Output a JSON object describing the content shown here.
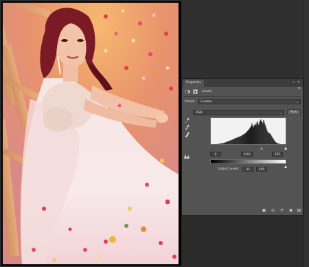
{
  "properties_panel": {
    "tab_label": "Properties",
    "collapse_glyph": "«",
    "close_glyph": "✕",
    "menu_glyph": "≡",
    "adjustment_label": "Levels",
    "preset_label": "Preset:",
    "preset_value": "Custom",
    "channel_value": "RGB",
    "auto_label": "Auto",
    "input_black": "0",
    "input_gamma": "0.93",
    "input_white": "255",
    "output_label": "Output Levels:",
    "output_black": "32",
    "output_white": "255",
    "dropdown_arrow": "⌄"
  },
  "icons": {
    "clip_layer": "clip-to-layer-icon",
    "view_previous": "view-previous-icon",
    "reset": "reset-icon",
    "visibility": "eye-icon",
    "delete": "trash-icon"
  },
  "histogram": {
    "bins": [
      0,
      0,
      0,
      0,
      0,
      0,
      0,
      0,
      0,
      0,
      1,
      1,
      1,
      2,
      2,
      3,
      3,
      4,
      4,
      5,
      6,
      7,
      8,
      9,
      10,
      11,
      12,
      13,
      14,
      15,
      16,
      17,
      18,
      20,
      21,
      22,
      23,
      24,
      25,
      26,
      27,
      28,
      29,
      30,
      31,
      33,
      35,
      36,
      38,
      40,
      41,
      43,
      46,
      49,
      52,
      55,
      58,
      62,
      66,
      70,
      80,
      72,
      64,
      70,
      74,
      78,
      72,
      82,
      88,
      78,
      74,
      85,
      90,
      94,
      88,
      84,
      80,
      92,
      86,
      76,
      70,
      62,
      54,
      48,
      44,
      40,
      42,
      38,
      36,
      30,
      26,
      22,
      18,
      14,
      10,
      8,
      6,
      4,
      3,
      2,
      1,
      1,
      0,
      0,
      0,
      0,
      0,
      0,
      0,
      0
    ]
  },
  "colors": {
    "panel_bg": "#535353",
    "tab_bg": "#3d3d3d",
    "workspace_bg": "#2b2b2b"
  }
}
